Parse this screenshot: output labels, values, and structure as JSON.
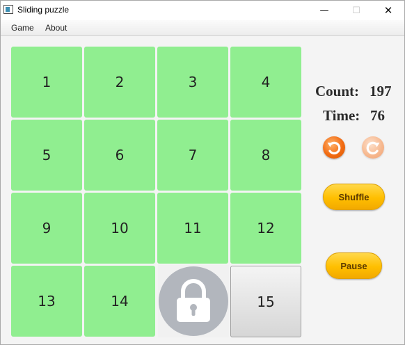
{
  "window": {
    "title": "Sliding puzzle",
    "minimize_symbol": "—",
    "maximize_symbol": "☐",
    "close_symbol": "✕"
  },
  "menu": {
    "items": [
      "Game",
      "About"
    ]
  },
  "board": {
    "tiles": [
      "1",
      "2",
      "3",
      "4",
      "5",
      "6",
      "7",
      "8",
      "9",
      "10",
      "11",
      "12",
      "13",
      "14",
      "",
      "15"
    ],
    "locked_cell_icon": "lock-icon",
    "highlighted_tile": "15",
    "colors": {
      "tile": "#90ee90",
      "highlighted_tile": "#e0e0e0",
      "lock": "#b2b6bd"
    }
  },
  "stats": {
    "count_label": "Count:",
    "count_value": "197",
    "time_label": "Time:",
    "time_value": "76"
  },
  "controls": {
    "undo_icon": "undo-icon",
    "redo_icon": "redo-icon",
    "shuffle_label": "Shuffle",
    "pause_label": "Pause",
    "accent": "#ffc107",
    "undo_color": "#f26b12"
  }
}
